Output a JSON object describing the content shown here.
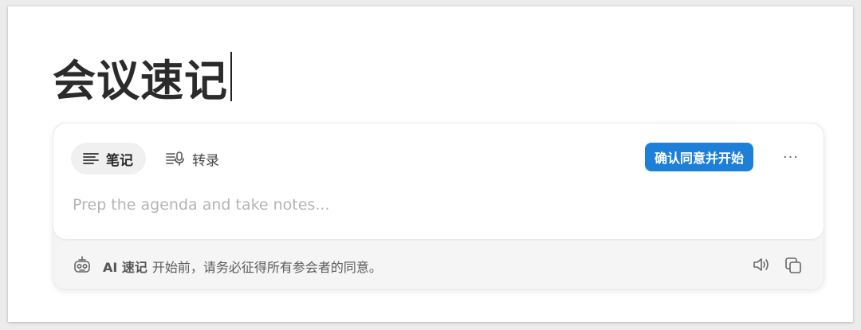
{
  "title": "会议速记",
  "tabs": {
    "notes": {
      "label": "笔记",
      "icon": "text-lines-icon",
      "active": true
    },
    "transcribe": {
      "label": "转录",
      "icon": "transcript-mic-icon",
      "active": false
    }
  },
  "consent_button": {
    "label": "确认同意并开始",
    "color": "#1d7fd8"
  },
  "more_button": {
    "label": "···",
    "icon": "more-horizontal-icon"
  },
  "notes_field": {
    "placeholder": "Prep the agenda and take notes...",
    "value": ""
  },
  "footer": {
    "icon": "ai-robot-icon",
    "brand": "AI 速记",
    "message": "开始前，请务必征得所有参会者的同意。",
    "speaker_icon": "speaker-icon",
    "copy_icon": "copy-icon"
  }
}
